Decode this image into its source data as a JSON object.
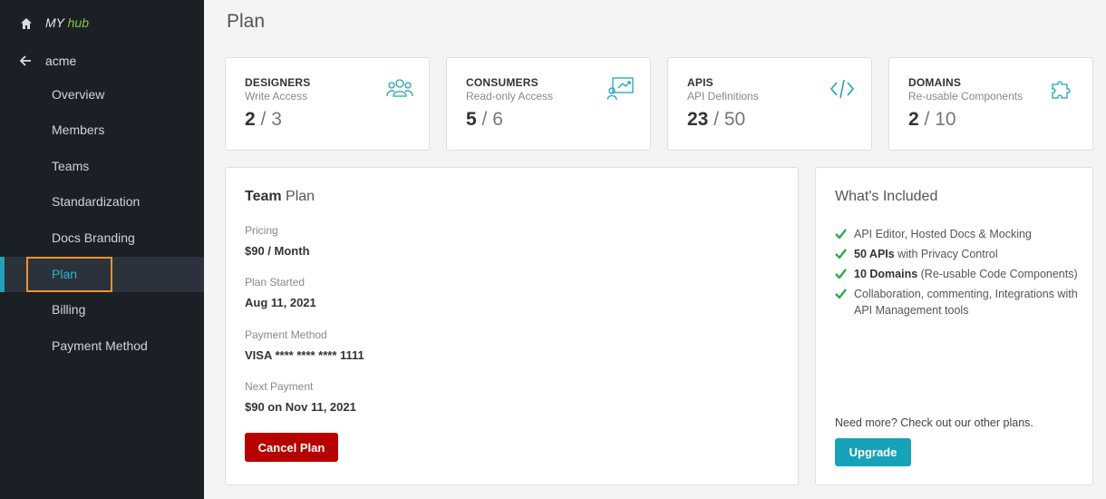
{
  "sidebar": {
    "brand_my": "MY",
    "brand_hub": "hub",
    "org": "acme",
    "items": [
      {
        "label": "Overview"
      },
      {
        "label": "Members"
      },
      {
        "label": "Teams"
      },
      {
        "label": "Standardization"
      },
      {
        "label": "Docs Branding"
      },
      {
        "label": "Plan"
      },
      {
        "label": "Billing"
      },
      {
        "label": "Payment Method"
      }
    ],
    "active_item": "Plan"
  },
  "page": {
    "title": "Plan"
  },
  "stats": [
    {
      "title": "DESIGNERS",
      "subtitle": "Write Access",
      "used": "2",
      "sep": " / ",
      "total": "3",
      "icon": "users-icon"
    },
    {
      "title": "CONSUMERS",
      "subtitle": "Read-only Access",
      "used": "5",
      "sep": " / ",
      "total": "6",
      "icon": "presentation-chart-icon"
    },
    {
      "title": "APIS",
      "subtitle": "API Definitions",
      "used": "23",
      "sep": " / ",
      "total": "50",
      "icon": "code-icon"
    },
    {
      "title": "DOMAINS",
      "subtitle": "Re-usable Components",
      "used": "2",
      "sep": " / ",
      "total": "10",
      "icon": "puzzle-icon"
    }
  ],
  "plan": {
    "title_bold": "Team",
    "title_rest": " Plan",
    "pricing_label": "Pricing",
    "pricing_value": "$90 / Month",
    "started_label": "Plan Started",
    "started_value": "Aug 11, 2021",
    "payment_label": "Payment Method",
    "payment_value": "VISA **** **** **** 1111",
    "next_label": "Next Payment",
    "next_value": "$90 on Nov 11, 2021",
    "cancel_label": "Cancel Plan"
  },
  "included": {
    "title": "What's Included",
    "items": [
      {
        "bold": "",
        "text": "API Editor, Hosted Docs & Mocking"
      },
      {
        "bold": "50 APIs",
        "text": " with Privacy Control"
      },
      {
        "bold": "10 Domains",
        "text": " (Re-usable Code Components)"
      },
      {
        "bold": "",
        "text": "Collaboration, commenting, Integrations with API Management tools"
      }
    ],
    "more_text": "Need more? Check out our other plans.",
    "upgrade_label": "Upgrade"
  },
  "colors": {
    "sidebar_bg": "#1b1f26",
    "accent": "#17a2b8",
    "hub_green": "#8cc63f",
    "highlight": "#f0922b",
    "danger": "#b70000",
    "check": "#2ea84a"
  }
}
